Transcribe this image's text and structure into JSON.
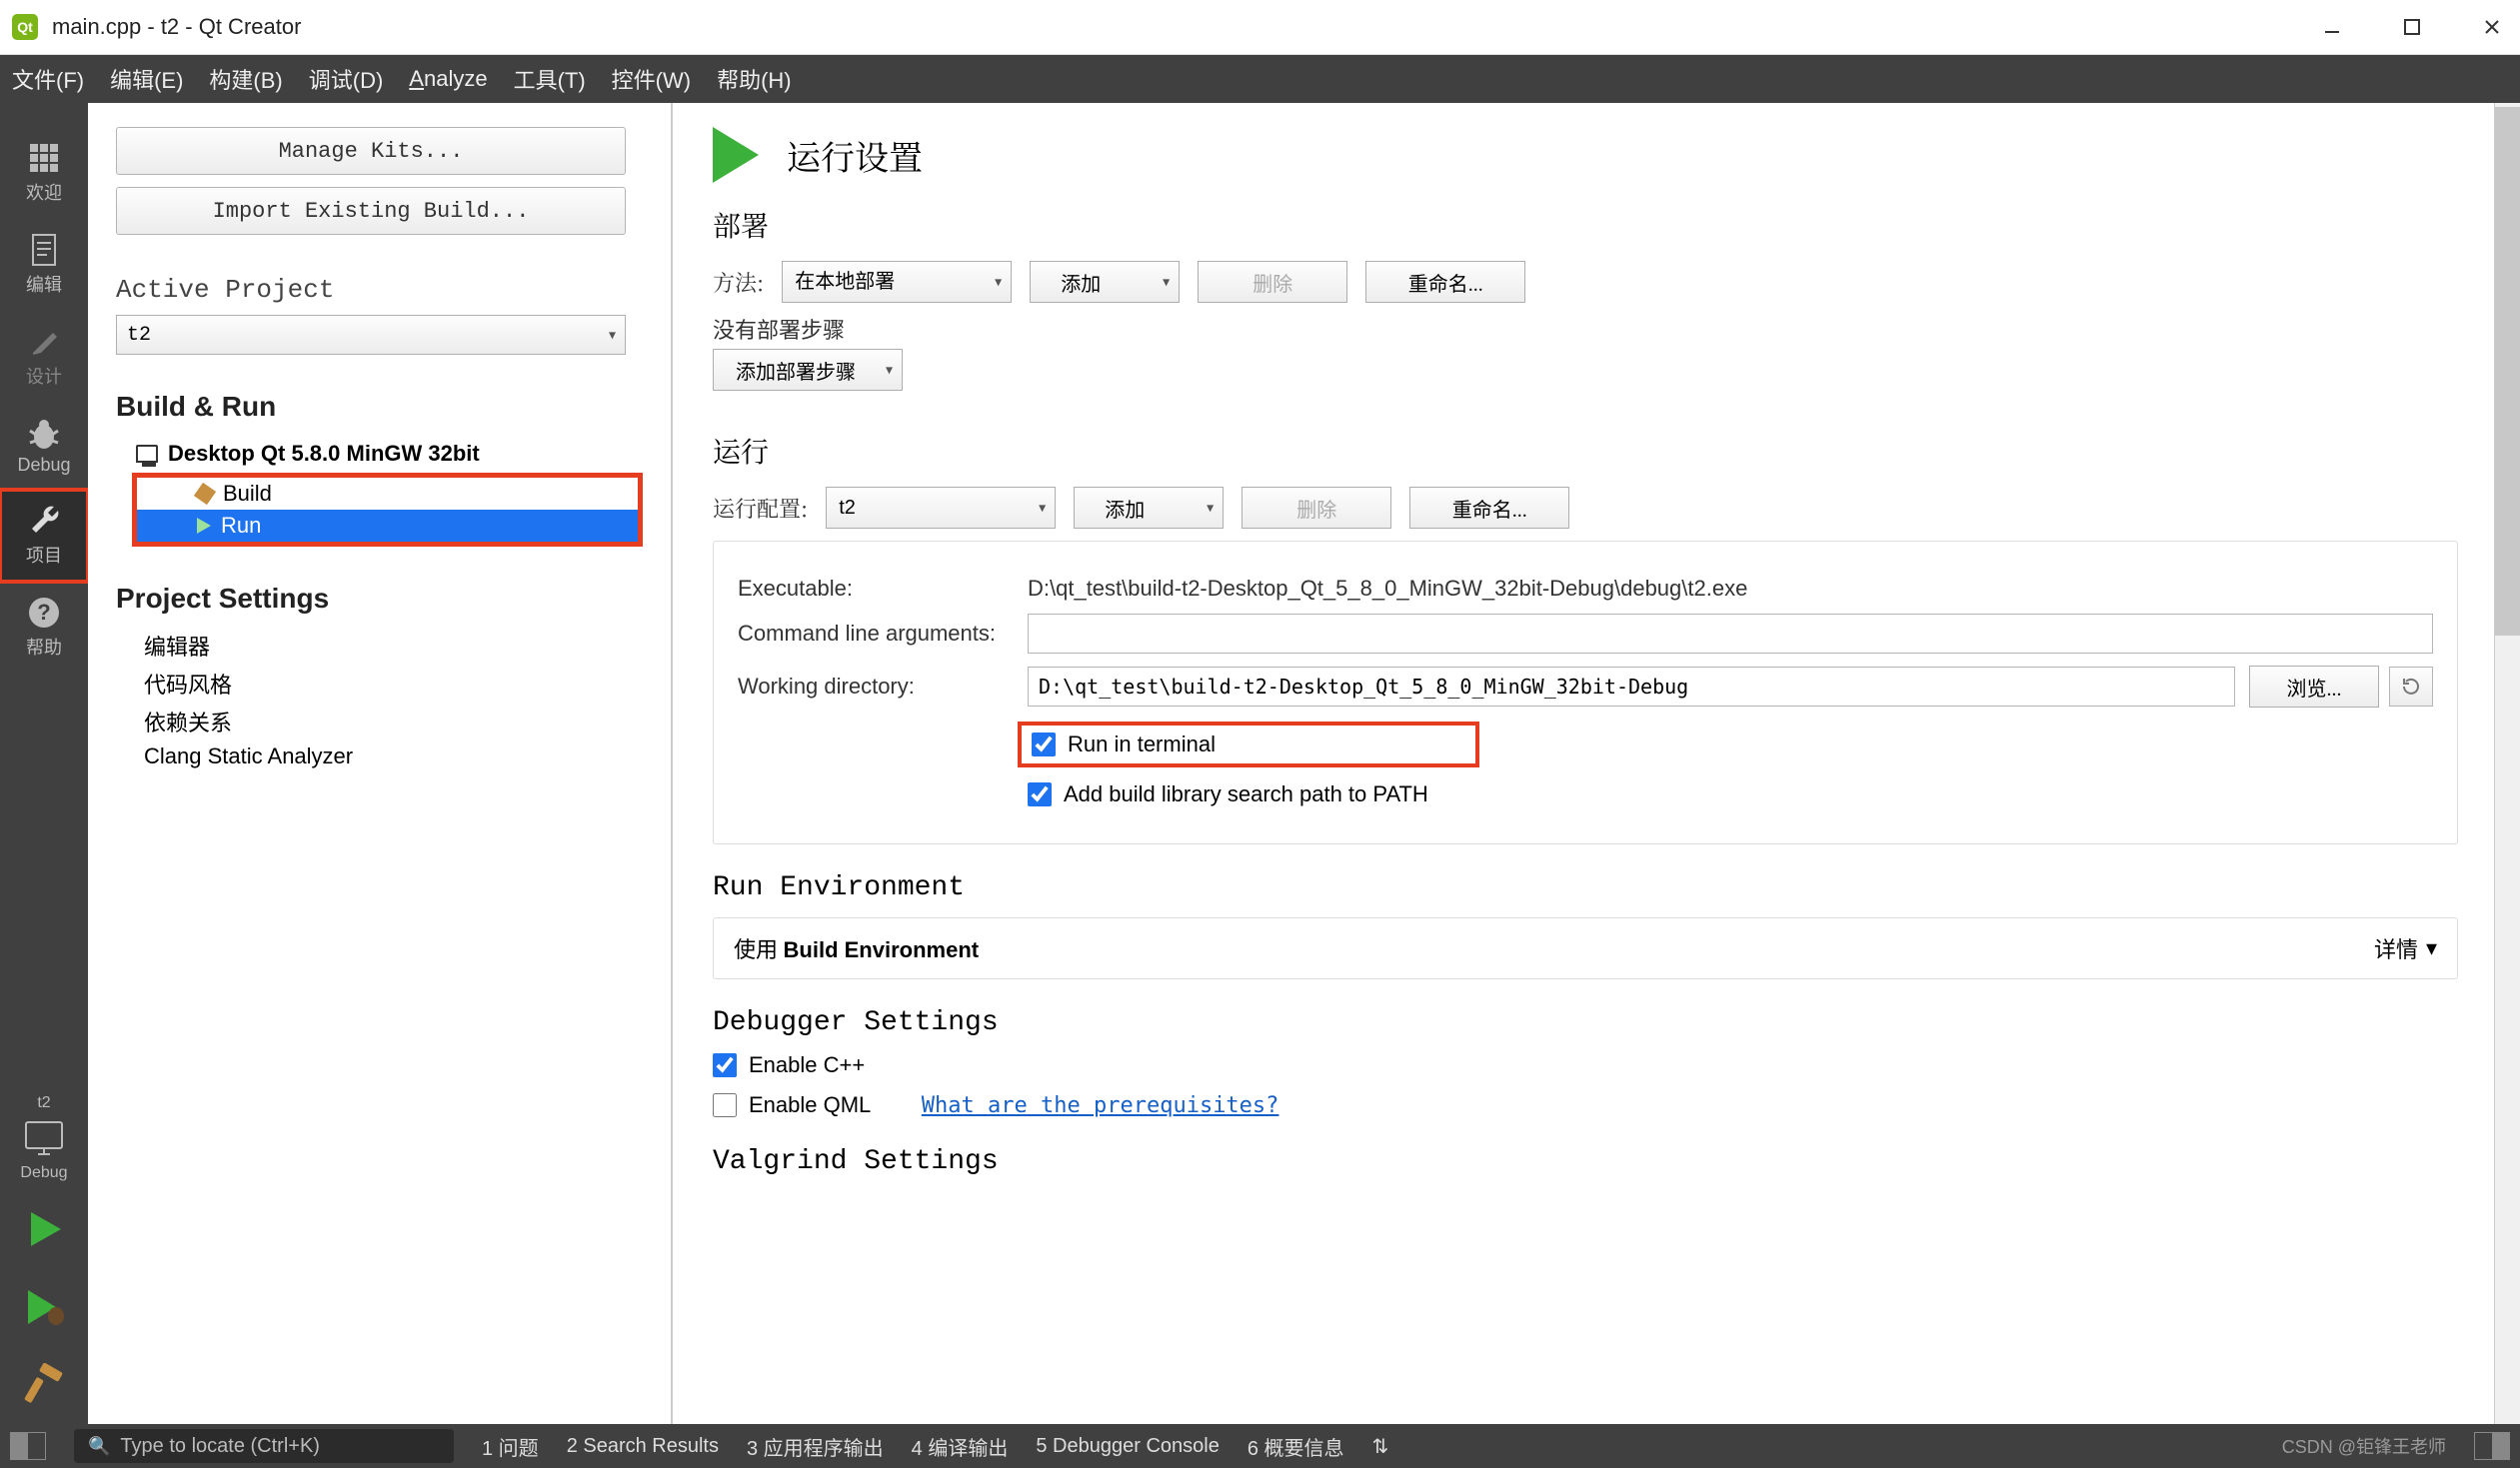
{
  "titlebar": {
    "title": "main.cpp - t2 - Qt Creator"
  },
  "menubar": {
    "file": "文件(F)",
    "edit": "编辑(E)",
    "build": "构建(B)",
    "debug": "调试(D)",
    "analyze": "Analyze",
    "tools": "工具(T)",
    "widgets": "控件(W)",
    "help": "帮助(H)"
  },
  "modebar": {
    "welcome": "欢迎",
    "edit": "编辑",
    "design": "设计",
    "debug": "Debug",
    "project": "项目",
    "help": "帮助",
    "target_name": "t2",
    "target_mode": "Debug"
  },
  "sidebar": {
    "manage_kits": "Manage Kits...",
    "import_build": "Import Existing Build...",
    "active_project_label": "Active Project",
    "active_project_value": "t2",
    "build_run_label": "Build & Run",
    "kit_name": "Desktop Qt 5.8.0 MinGW 32bit",
    "build_label": "Build",
    "run_label": "Run",
    "project_settings_label": "Project Settings",
    "ps_editor": "编辑器",
    "ps_codestyle": "代码风格",
    "ps_deps": "依赖关系",
    "ps_clang": "Clang Static Analyzer"
  },
  "main": {
    "heading": "运行设置",
    "deploy_heading": "部署",
    "method_label": "方法:",
    "method_value": "在本地部署",
    "btn_add": "添加",
    "btn_delete": "删除",
    "btn_rename": "重命名...",
    "no_deploy_steps": "没有部署步骤",
    "add_deploy_step": "添加部署步骤",
    "run_heading": "运行",
    "run_config_label": "运行配置:",
    "run_config_value": "t2",
    "exe_label": "Executable:",
    "exe_value": "D:\\qt_test\\build-t2-Desktop_Qt_5_8_0_MinGW_32bit-Debug\\debug\\t2.exe",
    "args_label": "Command line arguments:",
    "args_value": "",
    "wd_label": "Working directory:",
    "wd_value": "D:\\qt_test\\build-t2-Desktop_Qt_5_8_0_MinGW_32bit-Debug",
    "browse": "浏览...",
    "run_in_terminal": "Run in terminal",
    "add_lib_path": "Add build library search path to PATH",
    "env_heading": "Run Environment",
    "env_use_prefix": "使用 ",
    "env_use_bold": "Build Environment",
    "details": "详情",
    "dbg_heading": "Debugger Settings",
    "enable_cpp": "Enable C++",
    "enable_qml": "Enable QML",
    "qml_link": "What are the prerequisites?",
    "valgrind_heading": "Valgrind Settings"
  },
  "statusbar": {
    "search_placeholder": "Type to locate (Ctrl+K)",
    "i1": "1  问题",
    "i2": "2  Search Results",
    "i3": "3  应用程序输出",
    "i4": "4  编译输出",
    "i5": "5  Debugger Console",
    "i6": "6  概要信息",
    "watermark": "CSDN @钜锋王老师"
  }
}
